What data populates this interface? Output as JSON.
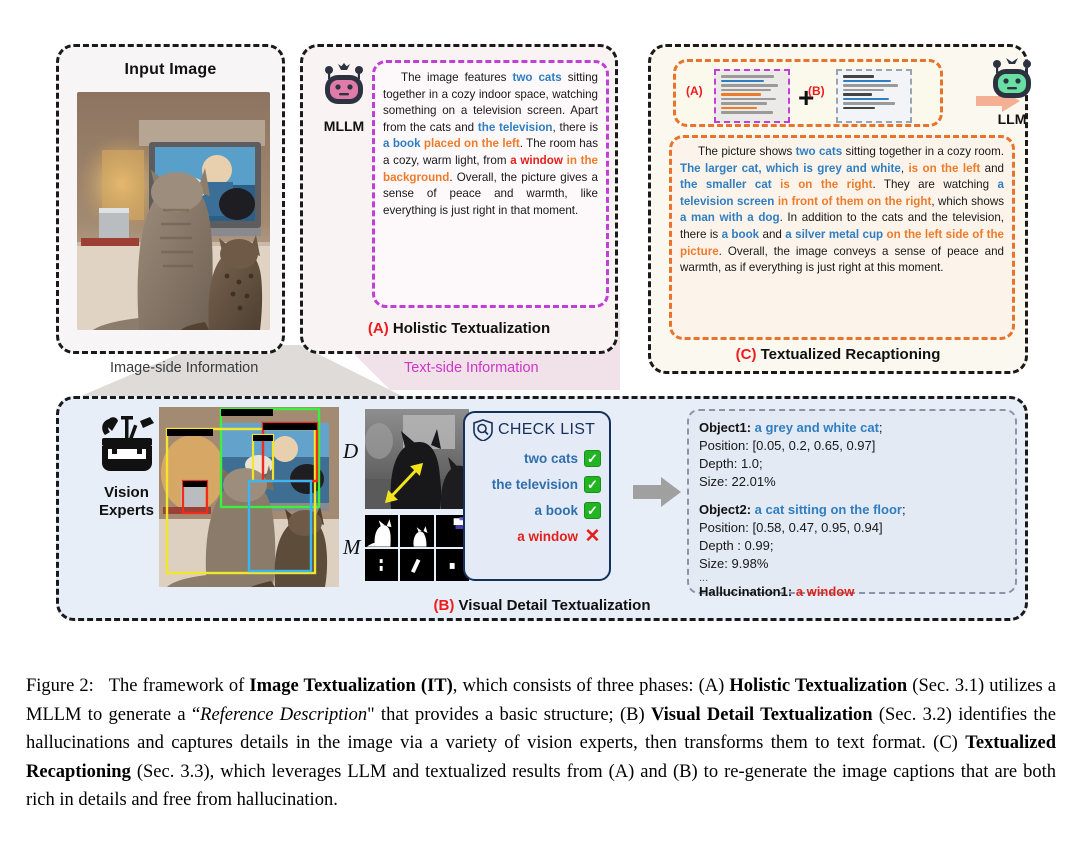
{
  "panels": {
    "input": {
      "title": "Input Image",
      "photo_alt": "two cats sitting on a floor watching a television"
    },
    "holistic": {
      "model_icon": "mllm-robot-icon",
      "model_label": "MLLM",
      "caption_tag": "(A)",
      "caption_text": "Holistic Textualization",
      "paragraph": [
        {
          "t": "The image features ",
          "c": "plain"
        },
        {
          "t": "two cats",
          "c": "blue"
        },
        {
          "t": " sitting together in a cozy indoor space, watching something on a television screen. Apart from the cats and ",
          "c": "plain"
        },
        {
          "t": "the television",
          "c": "blue"
        },
        {
          "t": ", there is ",
          "c": "plain"
        },
        {
          "t": "a book",
          "c": "blue"
        },
        {
          "t": " ",
          "c": "plain"
        },
        {
          "t": "placed on the left",
          "c": "orange"
        },
        {
          "t": ". The room has a cozy, warm light, from ",
          "c": "plain"
        },
        {
          "t": "a window",
          "c": "red"
        },
        {
          "t": " ",
          "c": "plain"
        },
        {
          "t": "in the background",
          "c": "orange"
        },
        {
          "t": ". Overall, the picture gives a sense of peace and warmth, like everything is just right in that moment.",
          "c": "plain"
        }
      ]
    },
    "labels": {
      "image_side": "Image-side Information",
      "text_side": "Text-side Information"
    },
    "recaption": {
      "combo": {
        "tag_a": "(A)",
        "tag_b": "(B)",
        "plus": "+",
        "arrow": "arrow-right-icon"
      },
      "model_icon": "llm-robot-icon",
      "model_label": "LLM",
      "caption_tag": "(C)",
      "caption_text": "Textualized Recaptioning",
      "paragraph": [
        {
          "t": "The picture shows ",
          "c": "plain"
        },
        {
          "t": "two cats",
          "c": "blue"
        },
        {
          "t": " sitting together in a cozy room. ",
          "c": "plain"
        },
        {
          "t": "The larger cat, which is grey and white",
          "c": "blue"
        },
        {
          "t": ", ",
          "c": "plain"
        },
        {
          "t": "is on the left",
          "c": "orange"
        },
        {
          "t": " and ",
          "c": "plain"
        },
        {
          "t": "the smaller cat",
          "c": "blue"
        },
        {
          "t": " ",
          "c": "plain"
        },
        {
          "t": "is on the right",
          "c": "orange"
        },
        {
          "t": ". They are watching ",
          "c": "plain"
        },
        {
          "t": "a television screen",
          "c": "blue"
        },
        {
          "t": " ",
          "c": "plain"
        },
        {
          "t": "in front of them on the right",
          "c": "orange"
        },
        {
          "t": ", which shows ",
          "c": "plain"
        },
        {
          "t": "a man with a dog",
          "c": "blue"
        },
        {
          "t": ". In addition to the cats and the television, there is ",
          "c": "plain"
        },
        {
          "t": "a book",
          "c": "blue"
        },
        {
          "t": " and ",
          "c": "plain"
        },
        {
          "t": "a silver metal cup",
          "c": "blue"
        },
        {
          "t": " ",
          "c": "plain"
        },
        {
          "t": "on the left side of the picture",
          "c": "orange"
        },
        {
          "t": ". Overall, the image conveys a sense of peace and warmth, as if everything is just right at this moment.",
          "c": "plain"
        }
      ]
    },
    "visual_detail": {
      "experts_icon": "toolbox-icon",
      "experts_label_line1": "Vision",
      "experts_label_line2": "Experts",
      "depth_letter": "D",
      "mask_letter": "M",
      "checklist": {
        "icon": "shield-search-icon",
        "title": "CHECK LIST",
        "items": [
          {
            "label": "two cats",
            "status": "check",
            "mark": "✓"
          },
          {
            "label": "the television",
            "status": "check",
            "mark": "✓"
          },
          {
            "label": "a book",
            "status": "check",
            "mark": "✓"
          },
          {
            "label": "a window",
            "status": "cross",
            "mark": "✕"
          }
        ]
      },
      "arrow": "arrow-right-icon",
      "objects": [
        {
          "name_key": "Object1",
          "name_value": "a grey and white cat",
          "position_label": "Position:",
          "position_value": "[0.05, 0.2, 0.65, 0.97]",
          "depth_label": "Depth:",
          "depth_value": "1.0;",
          "size_label": "Size:",
          "size_value": "22.01%"
        },
        {
          "name_key": "Object2",
          "name_value": "a cat sitting on the floor",
          "position_label": "Position:",
          "position_value": "[0.58, 0.47, 0.95, 0.94]",
          "depth_label": "Depth :",
          "depth_value": "0.99;",
          "size_label": "Size:",
          "size_value": "9.98%"
        }
      ],
      "ellipsis": "...",
      "hallucination_key": "Hallucination1",
      "hallucination_value": "a window",
      "caption_tag": "(B)",
      "caption_text": "Visual Detail Textualization"
    }
  },
  "figure_caption": {
    "number": "Figure 2:",
    "full": "The framework of Image Textualization (IT), which consists of three phases: (A) Holistic Textualization (Sec. 3.1) utilizes a MLLM to generate a “Reference Description\" that provides a basic structure; (B) Visual Detail Textualization (Sec. 3.2) identifies the hallucinations and captures details in the image via a variety of vision experts, then transforms them to text format. (C) Textualized Recaptioning (Sec. 3.3), which leverages LLM and textualized results from (A) and (B) to re-generate the image captions that are both rich in details and free from hallucination."
  },
  "colors": {
    "blue": "#2f7ec1",
    "orange": "#ec7c2c",
    "red": "#e3201c",
    "magenta": "#cc37c7",
    "panel_b_bg": "#e8eef7",
    "panel_c_bg": "#fbf9ef",
    "panel_a_bg": "#faf3f4",
    "check_green": "#22b422",
    "checklist_border": "#16305c"
  }
}
